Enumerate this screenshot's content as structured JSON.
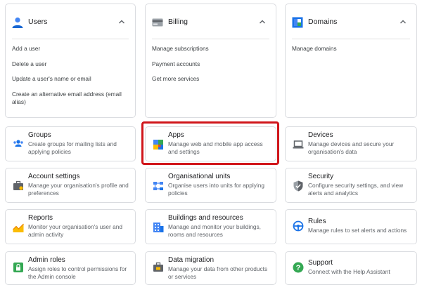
{
  "top_cards": [
    {
      "title": "Users",
      "icon": "person-icon",
      "links": [
        "Add a user",
        "Delete a user",
        "Update a user's name or email",
        "Create an alternative email address (email alias)"
      ]
    },
    {
      "title": "Billing",
      "icon": "credit-card-icon",
      "links": [
        "Manage subscriptions",
        "Payment accounts",
        "Get more services"
      ]
    },
    {
      "title": "Domains",
      "icon": "domain-icon",
      "links": [
        "Manage domains"
      ]
    }
  ],
  "cards": [
    {
      "title": "Groups",
      "desc": "Create groups for mailing lists and applying policies",
      "icon": "groups-icon"
    },
    {
      "title": "Apps",
      "desc": "Manage web and mobile app access and settings",
      "icon": "apps-icon"
    },
    {
      "title": "Devices",
      "desc": "Manage devices and secure your organisation's data",
      "icon": "laptop-icon"
    },
    {
      "title": "Account settings",
      "desc": "Manage your organisation's profile and preferences",
      "icon": "briefcase-icon"
    },
    {
      "title": "Organisational units",
      "desc": "Organise users into units for applying policies",
      "icon": "org-units-icon"
    },
    {
      "title": "Security",
      "desc": "Configure security settings, and view alerts and analytics",
      "icon": "shield-icon"
    },
    {
      "title": "Reports",
      "desc": "Monitor your organisation's user and admin activity",
      "icon": "reports-chart-icon"
    },
    {
      "title": "Buildings and resources",
      "desc": "Manage and monitor your buildings, rooms and resources",
      "icon": "buildings-icon"
    },
    {
      "title": "Rules",
      "desc": "Manage rules to set alerts and actions",
      "icon": "rules-icon"
    },
    {
      "title": "Admin roles",
      "desc": "Assign roles to control permissions for the Admin console",
      "icon": "lock-icon"
    },
    {
      "title": "Data migration",
      "desc": "Manage your data from other products or services",
      "icon": "migration-icon"
    },
    {
      "title": "Support",
      "desc": "Connect with the Help Assistant",
      "icon": "help-icon"
    }
  ],
  "highlight_color": "#d0151a"
}
